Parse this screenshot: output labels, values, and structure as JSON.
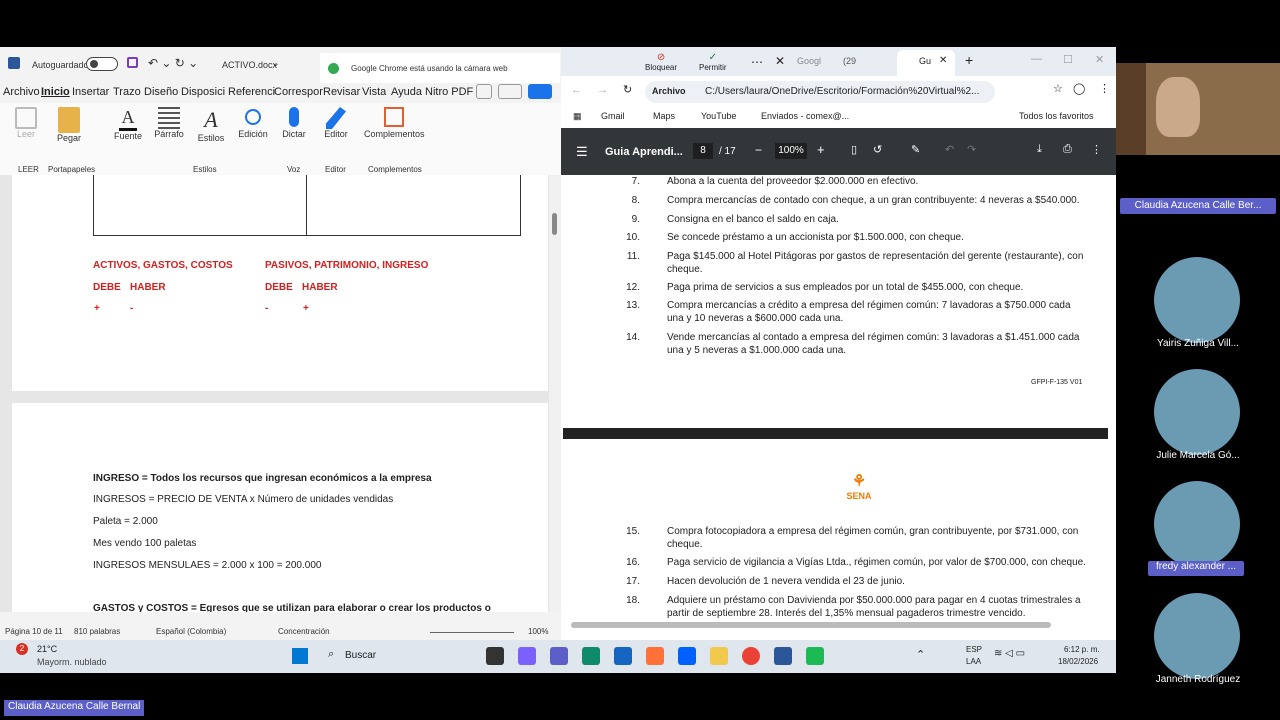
{
  "word": {
    "autosave": "Autoguardado",
    "filename": "ACTIVO.docx",
    "chrome_notice": "Google Chrome está usando la cámara web",
    "block": "Bloquear",
    "allow": "Permitir",
    "menu": [
      "Archivo",
      "Inicio",
      "Insertar",
      "Trazo",
      "Diseño",
      "Disposici",
      "Referenci",
      "Correspor",
      "Revisar",
      "Vista",
      "Ayuda",
      "Nitro PDF"
    ],
    "ribbon": {
      "leer": "Leer",
      "pegar": "Pegar",
      "fuente": "Fuente",
      "parrafo": "Párrafo",
      "estilos": "Estilos",
      "edicion": "Edición",
      "dictar": "Dictar",
      "editor": "Editor",
      "complementos": "Complementos"
    },
    "groups": {
      "leer": "LEER",
      "portapapeles": "Portapapeles",
      "estilos": "Estilos",
      "voz": "Voz",
      "editor": "Editor",
      "complementos": "Complementos"
    },
    "doc": {
      "h_left": "ACTIVOS, GASTOS, COSTOS",
      "h_right": "PASIVOS, PATRIMONIO, INGRESO",
      "debe": "DEBE",
      "haber": "HABER",
      "plus": "+",
      "minus": "-",
      "ingreso_bold": "INGRESO = Todos los recursos que ingresan económicos a la empresa",
      "l1": "INGRESOS = PRECIO DE VENTA x Número de unidades vendidas",
      "l2": "Paleta = 2.000",
      "l3": "Mes vendo 100 paletas",
      "l4": "INGRESOS MENSULAES = 2.000 x 100 = 200.000",
      "l5": "GASTOS y COSTOS = Egresos que se utilizan para elaborar o crear los productos o"
    },
    "status": {
      "page": "Página 10 de 11",
      "words": "810 palabras",
      "lang": "Español (Colombia)",
      "focus": "Concentración",
      "zoom": "100%"
    }
  },
  "chrome": {
    "tabs": [
      {
        "label": "Googl"
      },
      {
        "label": "(29"
      },
      {
        "label": "Gu"
      }
    ],
    "archivo": "Archivo",
    "url": "C:/Users/laura/OneDrive/Escritorio/Formación%20Virtual%2...",
    "bookmarks": [
      "Gmail",
      "Maps",
      "YouTube",
      "Enviados - comex@..."
    ],
    "all_fav": "Todos los favoritos",
    "pdf": {
      "title": "Guia Aprendi...",
      "page": "8",
      "total": "/ 17",
      "zoom": "100%"
    },
    "items": [
      {
        "n": "7.",
        "t": "Abona a la cuenta del proveedor $2.000.000 en efectivo."
      },
      {
        "n": "8.",
        "t": "Compra mercancías de contado con cheque, a un gran contribuyente: 4 neveras a $540.000."
      },
      {
        "n": "9.",
        "t": "Consigna en el banco el saldo en caja."
      },
      {
        "n": "10.",
        "t": "Se concede préstamo a un accionista por $1.500.000, con cheque."
      },
      {
        "n": "11.",
        "t": "Paga $145.000 al Hotel Pitágoras por gastos de representación del gerente (restaurante), con cheque."
      },
      {
        "n": "12.",
        "t": "Paga prima de servicios a sus empleados por un total de $455.000, con cheque."
      },
      {
        "n": "13.",
        "t": "Compra mercancías a crédito a empresa del régimen común: 7 lavadoras a $750.000 cada una y 10 neveras a $600.000 cada una."
      },
      {
        "n": "14.",
        "t": "Vende mercancías al contado a empresa del régimen común: 3 lavadoras a $1.451.000 cada una y 5 neveras a $1.000.000 cada una."
      }
    ],
    "code": "GFPI-F-135 V01",
    "sena": "SENA",
    "items2": [
      {
        "n": "15.",
        "t": "Compra fotocopiadora a empresa del régimen común, gran contribuyente, por $731.000, con cheque."
      },
      {
        "n": "16.",
        "t": "Paga servicio de vigilancia a Vigías Ltda., régimen común, por valor de $700.000, con cheque."
      },
      {
        "n": "17.",
        "t": "Hacen devolución de 1 nevera vendida el 23 de junio."
      },
      {
        "n": "18.",
        "t": "Adquiere un préstamo con Davivienda por $50.000.000 para pagar en 4 cuotas trimestrales a partir de septiembre 28.  Interés del 1,35% mensual pagaderos trimestre vencido."
      }
    ]
  },
  "taskbar": {
    "temp": "21°C",
    "weather": "Mayorm. nublado",
    "search": "Buscar",
    "lang1": "ESP",
    "lang2": "LAA",
    "time": "6:12 p. m.",
    "date": "18/02/2026",
    "badge": "2"
  },
  "participants": [
    "Claudia Azucena Calle Ber...",
    "Yairis Zuñiga Vill...",
    "Julie Marcela Gó...",
    "fredy alexander ...",
    "Janneth Rodríguez"
  ],
  "presenter": "Claudia Azucena Calle Bernal"
}
